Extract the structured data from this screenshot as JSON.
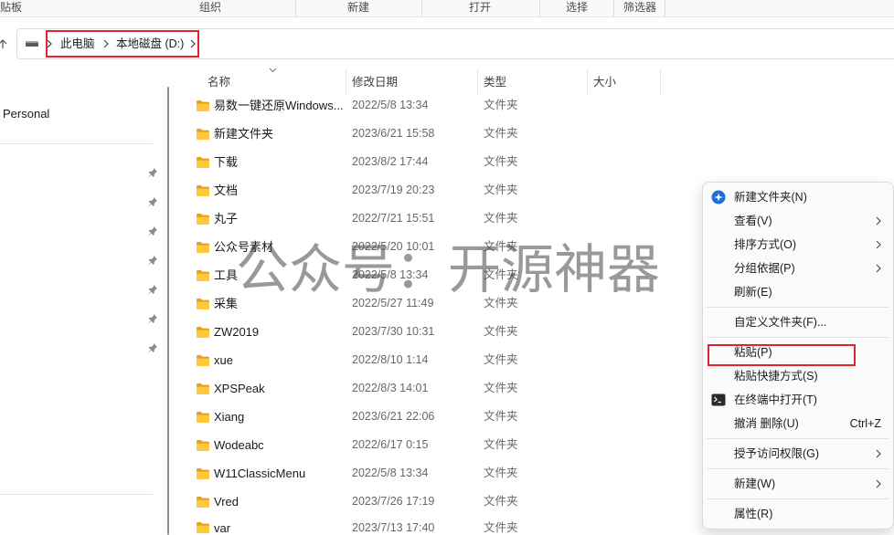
{
  "ribbon": {
    "groups": [
      "贴板",
      "组织",
      "新建",
      "打开",
      "选择",
      "筛选器"
    ]
  },
  "address_bar": {
    "up_icon": "arrow-up-icon",
    "drive_icon": "drive-icon",
    "separator_icon": "chevron-right-icon",
    "crumbs": [
      "此电脑",
      "本地磁盘 (D:)"
    ]
  },
  "nav_pane": {
    "items": [
      "Personal"
    ],
    "pin_icon": "pin-icon"
  },
  "file_list": {
    "columns": {
      "name": "名称",
      "modified": "修改日期",
      "type": "类型",
      "size": "大小"
    },
    "sort_icon": "chevron-down-icon",
    "item_icon": "folder-icon",
    "rows": [
      {
        "name": "易数一键还原Windows...",
        "modified": "2022/5/8 13:34",
        "type": "文件夹"
      },
      {
        "name": "新建文件夹",
        "modified": "2023/6/21 15:58",
        "type": "文件夹"
      },
      {
        "name": "下载",
        "modified": "2023/8/2 17:44",
        "type": "文件夹"
      },
      {
        "name": "文档",
        "modified": "2023/7/19 20:23",
        "type": "文件夹"
      },
      {
        "name": "丸子",
        "modified": "2022/7/21 15:51",
        "type": "文件夹"
      },
      {
        "name": "公众号素材",
        "modified": "2022/5/20 10:01",
        "type": "文件夹"
      },
      {
        "name": "工具",
        "modified": "2022/5/8 13:34",
        "type": "文件夹"
      },
      {
        "name": "采集",
        "modified": "2022/5/27 11:49",
        "type": "文件夹"
      },
      {
        "name": "ZW2019",
        "modified": "2023/7/30 10:31",
        "type": "文件夹"
      },
      {
        "name": "xue",
        "modified": "2022/8/10 1:14",
        "type": "文件夹"
      },
      {
        "name": "XPSPeak",
        "modified": "2022/8/3 14:01",
        "type": "文件夹"
      },
      {
        "name": "Xiang",
        "modified": "2023/6/21 22:06",
        "type": "文件夹"
      },
      {
        "name": "Wodeabc",
        "modified": "2022/6/17 0:15",
        "type": "文件夹"
      },
      {
        "name": "W11ClassicMenu",
        "modified": "2022/5/8 13:34",
        "type": "文件夹"
      },
      {
        "name": "Vred",
        "modified": "2023/7/26 17:19",
        "type": "文件夹"
      },
      {
        "name": "var",
        "modified": "2023/7/13 17:40",
        "type": "文件夹"
      }
    ]
  },
  "watermark": "公众号：开源神器",
  "context_menu": {
    "items": [
      {
        "label": "新建文件夹(N)",
        "icon": "new-folder-icon"
      },
      {
        "label": "查看(V)",
        "submenu": true
      },
      {
        "label": "排序方式(O)",
        "submenu": true
      },
      {
        "label": "分组依据(P)",
        "submenu": true
      },
      {
        "label": "刷新(E)"
      },
      {
        "label": "自定义文件夹(F)..."
      },
      {
        "label": "粘贴(P)",
        "highlighted": true
      },
      {
        "label": "粘贴快捷方式(S)"
      },
      {
        "label": "在终端中打开(T)",
        "icon": "terminal-icon"
      },
      {
        "label": "撤消 删除(U)",
        "shortcut": "Ctrl+Z"
      },
      {
        "label": "授予访问权限(G)",
        "submenu": true
      },
      {
        "label": "新建(W)",
        "submenu": true
      },
      {
        "label": "属性(R)"
      }
    ]
  },
  "colors": {
    "highlight": "#e0252a",
    "folder_front": "#ffc83d",
    "folder_back": "#e5a01c",
    "accent": "#1a6fd8"
  }
}
